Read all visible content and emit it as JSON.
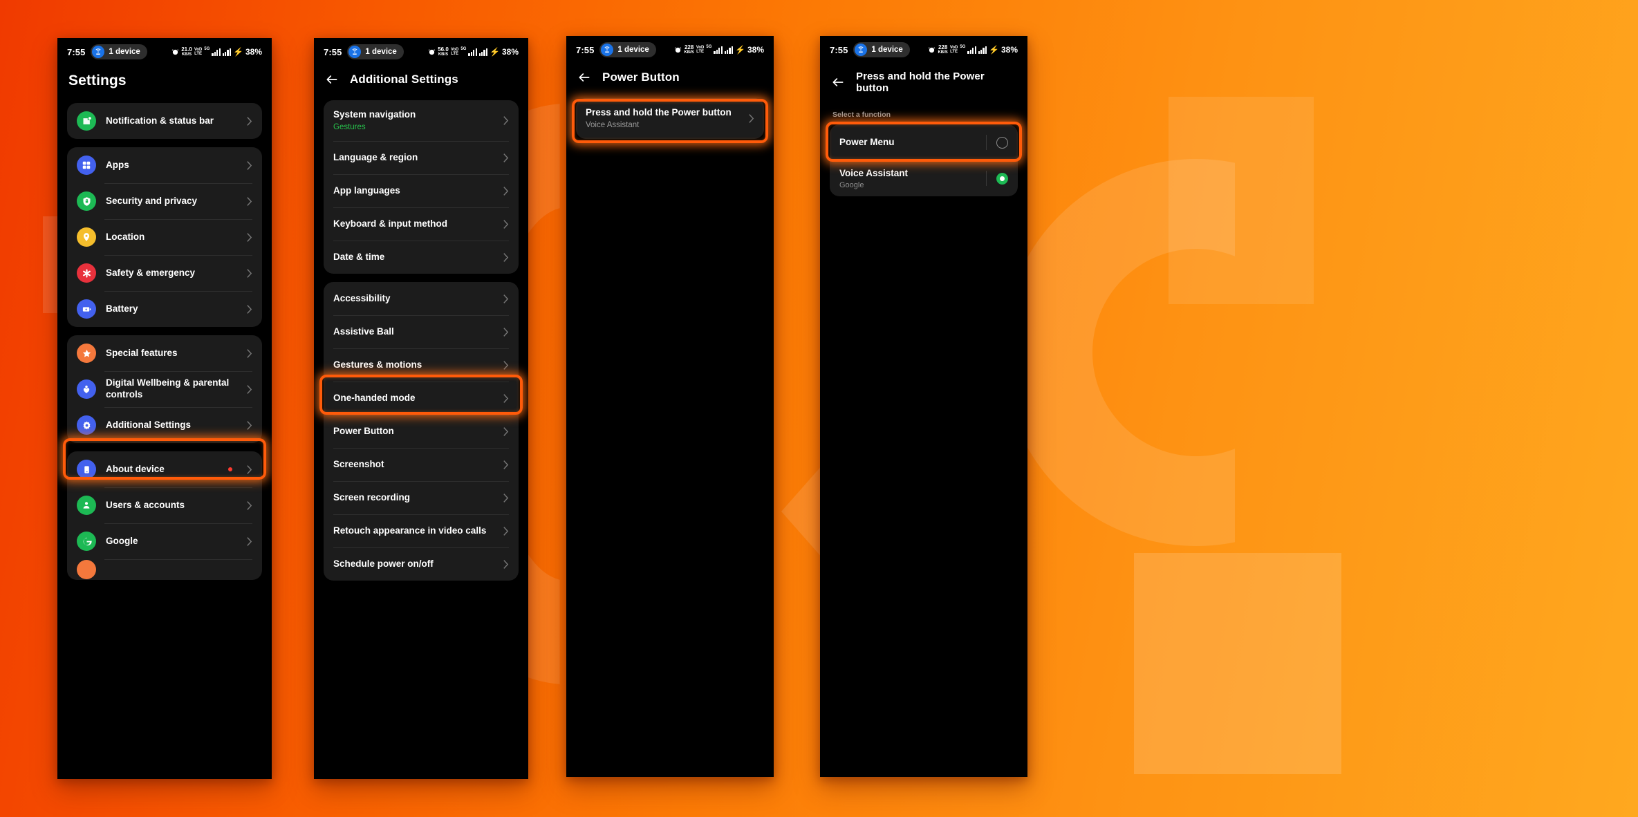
{
  "background": {
    "gradient_from": "#F03A00",
    "gradient_to": "#FFA81F",
    "accent": "#FF5B0A"
  },
  "status_bar_common": {
    "time": "7:55",
    "pill_label": "1 device",
    "volte_line1": "VoD",
    "volte_line2": "LTE",
    "network": "5G",
    "battery": "38%",
    "speed_unit": "KB/S"
  },
  "phones": [
    {
      "id": "phone-settings",
      "status": {
        "speed_value": "21.0"
      },
      "appbar": {
        "title": "Settings",
        "has_back": false
      },
      "groups": [
        {
          "items": [
            {
              "label": "Notification & status bar",
              "icon": "notification-icon",
              "icon_color": "#1DB954"
            }
          ]
        },
        {
          "items": [
            {
              "label": "Apps",
              "icon": "apps-grid-icon",
              "icon_color": "#4361EE"
            },
            {
              "label": "Security and privacy",
              "icon": "shield-lock-icon",
              "icon_color": "#1DB954"
            },
            {
              "label": "Location",
              "icon": "location-pin-icon",
              "icon_color": "#F5BE2C"
            },
            {
              "label": "Safety & emergency",
              "icon": "emergency-asterisk-icon",
              "icon_color": "#E8313C"
            },
            {
              "label": "Battery",
              "icon": "battery-icon",
              "icon_color": "#4361EE"
            }
          ]
        },
        {
          "items": [
            {
              "label": "Special features",
              "icon": "star-icon",
              "icon_color": "#F4783C"
            },
            {
              "label": "Digital Wellbeing & parental controls",
              "icon": "wellbeing-icon",
              "icon_color": "#4361EE"
            },
            {
              "label": "Additional Settings",
              "icon": "gear-icon",
              "icon_color": "#4361EE",
              "highlighted": true
            }
          ]
        },
        {
          "items": [
            {
              "label": "About device",
              "icon": "phone-device-icon",
              "icon_color": "#4361EE",
              "badge": true
            },
            {
              "label": "Users & accounts",
              "icon": "user-icon",
              "icon_color": "#1DB954"
            },
            {
              "label": "Google",
              "icon": "google-icon",
              "icon_color": "#1DB954"
            }
          ]
        }
      ]
    },
    {
      "id": "phone-additional-settings",
      "status": {
        "speed_value": "56.0"
      },
      "appbar": {
        "title": "Additional Settings",
        "has_back": true
      },
      "groups": [
        {
          "items": [
            {
              "label": "System navigation",
              "sublabel": "Gestures"
            },
            {
              "label": "Language & region"
            },
            {
              "label": "App languages"
            },
            {
              "label": "Keyboard & input method"
            },
            {
              "label": "Date & time"
            }
          ]
        },
        {
          "items": [
            {
              "label": "Accessibility"
            },
            {
              "label": "Assistive Ball"
            },
            {
              "label": "Gestures & motions"
            },
            {
              "label": "One-handed mode"
            },
            {
              "label": "Power Button",
              "highlighted": true
            },
            {
              "label": "Screenshot"
            },
            {
              "label": "Screen recording"
            },
            {
              "label": "Retouch appearance in video calls"
            },
            {
              "label": "Schedule power on/off"
            }
          ]
        }
      ]
    },
    {
      "id": "phone-power-button",
      "status": {
        "speed_value": "228"
      },
      "appbar": {
        "title": "Power Button",
        "has_back": true
      },
      "groups": [
        {
          "items": [
            {
              "label": "Press and hold the Power button",
              "sublabel": "Voice Assistant",
              "highlighted": true
            }
          ]
        }
      ]
    },
    {
      "id": "phone-press-and-hold",
      "status": {
        "speed_value": "228"
      },
      "appbar": {
        "title": "Press and hold the Power button",
        "has_back": true
      },
      "section_header": "Select a function",
      "options": [
        {
          "label": "Power Menu",
          "selected": false,
          "highlighted": true
        },
        {
          "label": "Voice Assistant",
          "sublabel": "Google",
          "selected": true
        }
      ]
    }
  ]
}
